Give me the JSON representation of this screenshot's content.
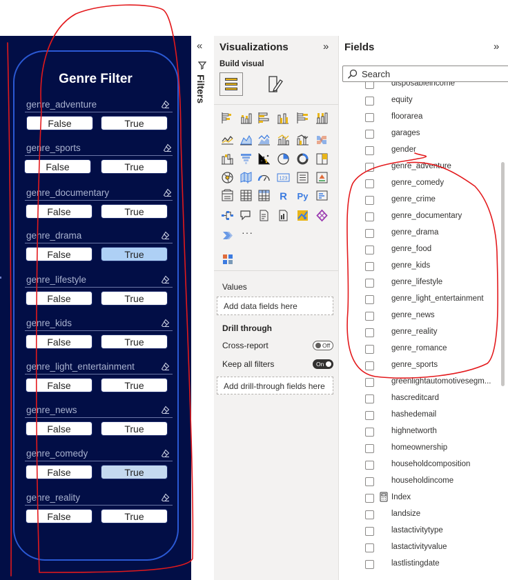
{
  "slicer": {
    "title": "Genre Filter",
    "false_label": "False",
    "true_label": "True",
    "items": [
      {
        "label": "genre_adventure",
        "selected": "none"
      },
      {
        "label": "genre_sports",
        "selected": "none"
      },
      {
        "label": "genre_documentary",
        "selected": "none"
      },
      {
        "label": "genre_drama",
        "selected": "true"
      },
      {
        "label": "genre_lifestyle",
        "selected": "none"
      },
      {
        "label": "genre_kids",
        "selected": "none"
      },
      {
        "label": "genre_light_entertainment",
        "selected": "none"
      },
      {
        "label": "genre_news",
        "selected": "none"
      },
      {
        "label": "genre_comedy",
        "selected": "true"
      },
      {
        "label": "genre_reality",
        "selected": "none"
      }
    ]
  },
  "filters_pane": {
    "label": "Filters"
  },
  "visualizations": {
    "title": "Visualizations",
    "build_visual_label": "Build visual",
    "icons": [
      "stacked-bar-chart",
      "stacked-column-chart",
      "clustered-bar-chart",
      "clustered-column-chart",
      "100-stacked-bar-chart",
      "100-stacked-column-chart",
      "line-chart",
      "area-chart",
      "stacked-area-chart",
      "line-stacked-column-chart",
      "line-clustered-column-chart",
      "ribbon-chart",
      "waterfall-chart",
      "funnel-chart",
      "scatter-chart",
      "pie-chart",
      "donut-chart",
      "treemap",
      "map",
      "filled-map",
      "gauge",
      "card",
      "multi-row-card",
      "kpi",
      "slicer",
      "table",
      "matrix",
      "r-visual",
      "python-visual",
      "key-influencers",
      "decomposition-tree",
      "qa-visual",
      "smart-narrative",
      "paginated-report",
      "arcgis-map",
      "power-apps",
      "power-automate",
      "more-visuals",
      "get-more-visuals"
    ],
    "r_glyph": "R",
    "py_glyph": "Py",
    "card_glyph": "123",
    "more_dots": "···",
    "values_label": "Values",
    "values_placeholder": "Add data fields here",
    "drill_through_label": "Drill through",
    "cross_report_label": "Cross-report",
    "cross_report_state": "Off",
    "keep_filters_label": "Keep all filters",
    "keep_filters_state": "On",
    "drill_placeholder": "Add drill-through fields here"
  },
  "fields": {
    "title": "Fields",
    "search_placeholder": "Search",
    "items": [
      "disposableincome",
      "equity",
      "floorarea",
      "garages",
      "gender",
      "genre_adventure",
      "genre_comedy",
      "genre_crime",
      "genre_documentary",
      "genre_drama",
      "genre_food",
      "genre_kids",
      "genre_lifestyle",
      "genre_light_entertainment",
      "genre_news",
      "genre_reality",
      "genre_romance",
      "genre_sports",
      "greenlightautomotivesegm...",
      "hascreditcard",
      "hashedemail",
      "highnetworth",
      "homeownership",
      "householdcomposition",
      "householdincome",
      "Index",
      "landsize",
      "lastactivitytype",
      "lastactivityvalue",
      "lastlistingdate"
    ],
    "calculated_item": "Index"
  },
  "colors": {
    "canvas_bg": "#020e46",
    "panel_border": "#2b59d4",
    "selected_button": "#aed0f5",
    "annotation_red": "#e3191c",
    "pane_bg": "#f3f2f1",
    "accent_yellow": "#e8b51a"
  }
}
